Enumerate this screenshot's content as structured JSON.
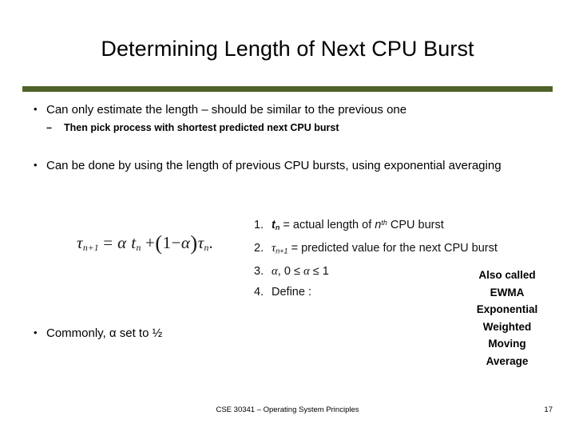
{
  "slide": {
    "title": "Determining Length of Next CPU Burst",
    "accent_color": "#4f6228",
    "background_color": "#ffffff",
    "text_color": "#000000"
  },
  "bullets": [
    {
      "level": 1,
      "marker": "•",
      "text": "Can only estimate the length – should be similar to the previous one"
    },
    {
      "level": 2,
      "marker": "–",
      "text": "Then pick process with shortest predicted next CPU burst"
    },
    {
      "level": 1,
      "marker": "•",
      "text": "Can be done by using the length of previous CPU bursts, using exponential averaging"
    },
    {
      "level": 1,
      "marker": "•",
      "text": "Commonly, α set to ½"
    }
  ],
  "formula": {
    "plain": "τ n+1 = α t n + (1 − α) τ n .",
    "tau": "τ",
    "sub_n_plus_1": "n+1",
    "equals": "=",
    "alpha": "α",
    "t": "t",
    "sub_n": "n",
    "plus": "+",
    "open_paren": "(",
    "one": "1",
    "minus": "−",
    "close_paren": ")",
    "period": "."
  },
  "definitions": [
    {
      "number": "1.",
      "lhs_symbol": "t",
      "lhs_sub": "n",
      "equals": "=",
      "text_before": "actual  length of ",
      "var": "n",
      "sup": "th",
      "text_after": " CPU  burst",
      "plain": "t_n = actual length of n^th CPU burst"
    },
    {
      "number": "2.",
      "lhs_symbol": "τ",
      "lhs_sub": "n+1",
      "equals": "=",
      "text_before": "predicted value for the next CPU  burst",
      "plain": "τ_n+1 = predicted value for the next CPU burst"
    },
    {
      "number": "3.",
      "plain": "α, 0 ≤ α ≤ 1",
      "alpha": "α",
      "comma": ",",
      "zero": "0",
      "le1": "≤",
      "alpha2": "α",
      "le2": "≤",
      "one": "1"
    },
    {
      "number": "4.",
      "plain": "Define :",
      "label": "Define",
      "colon": ":"
    }
  ],
  "ewma_caption": {
    "lines": [
      "Also called",
      "EWMA",
      "Exponential",
      "Weighted",
      "Moving",
      "Average"
    ]
  },
  "footer": {
    "course": "CSE 30341 – Operating System Principles",
    "page_number": "17"
  }
}
